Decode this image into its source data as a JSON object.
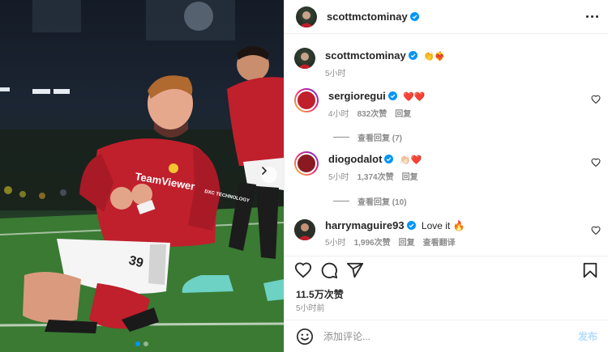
{
  "post": {
    "author": "scottmctominay",
    "verified": true,
    "caption": "👏❤️‍🔥",
    "caption_time": "5小时",
    "photo": {
      "jersey_sponsor": "TeamViewer",
      "jersey_number": "39",
      "sleeve_sponsor": "DXC TECHNOLOGY",
      "carousel_position": 1,
      "carousel_count": 2
    }
  },
  "comments": [
    {
      "username": "sergioregui",
      "verified": true,
      "text": "❤️❤️",
      "time": "4小时",
      "likes": "832次赞",
      "reply_label": "回复",
      "view_replies": "查看回复 (7)"
    },
    {
      "username": "diogodalot",
      "verified": true,
      "text": "👏🏻❤️",
      "time": "5小时",
      "likes": "1,374次赞",
      "reply_label": "回复",
      "view_replies": "查看回复 (10)"
    },
    {
      "username": "harrymaguire93",
      "verified": true,
      "text": "Love it 🔥",
      "time": "5小时",
      "likes": "1,996次赞",
      "reply_label": "回复",
      "translate_label": "查看翻译"
    }
  ],
  "stats": {
    "likes": "11.5万次赞",
    "posted": "5小时前"
  },
  "composer": {
    "placeholder": "添加评论...",
    "post_label": "发布"
  },
  "colors": {
    "verified": "#0095f6",
    "post_disabled": "#b3dbff",
    "jersey_red": "#c01f2c",
    "muted": "#8e8e8e"
  },
  "icons": [
    "more-icon",
    "heart-icon",
    "comment-icon",
    "share-icon",
    "bookmark-icon",
    "emoji-icon",
    "verified-badge-icon",
    "chevron-right-icon"
  ]
}
